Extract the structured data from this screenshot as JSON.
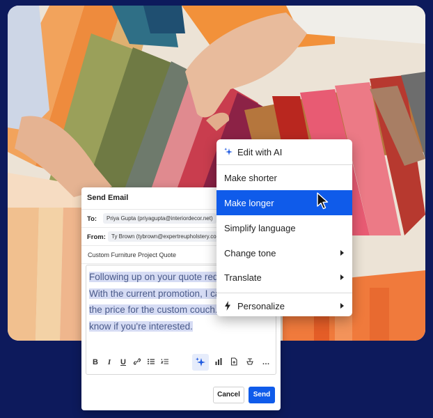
{
  "email": {
    "title": "Send Email",
    "to_label": "To:",
    "to_value": "Priya Gupta (priyagupta@interiordecor.net)",
    "from_label": "From:",
    "from_value": "Ty Brown (tybrown@expertreupholstery.com)",
    "subject": "Custom Furniture Project Quote",
    "body_lines": [
      "Following up on your quote request.",
      "With the current promotion, I can lower",
      "the price for the custom couch. Let me",
      "know if you're interested."
    ],
    "toolbar": {
      "bold": "B",
      "italic": "I",
      "underline": "U",
      "more": "…"
    },
    "cancel_label": "Cancel",
    "send_label": "Send"
  },
  "ai_menu": {
    "header": "Edit with AI",
    "items": [
      {
        "label": "Make shorter"
      },
      {
        "label": "Make longer",
        "active": true
      },
      {
        "label": "Simplify language"
      },
      {
        "label": "Change tone",
        "submenu": true
      },
      {
        "label": "Translate",
        "submenu": true
      }
    ],
    "footer": "Personalize"
  },
  "colors": {
    "page_background": "#0d1a5c",
    "accent": "#0f5bea",
    "selection_highlight": "#d6dcf4",
    "ai_icon": "#1f5ae0"
  }
}
